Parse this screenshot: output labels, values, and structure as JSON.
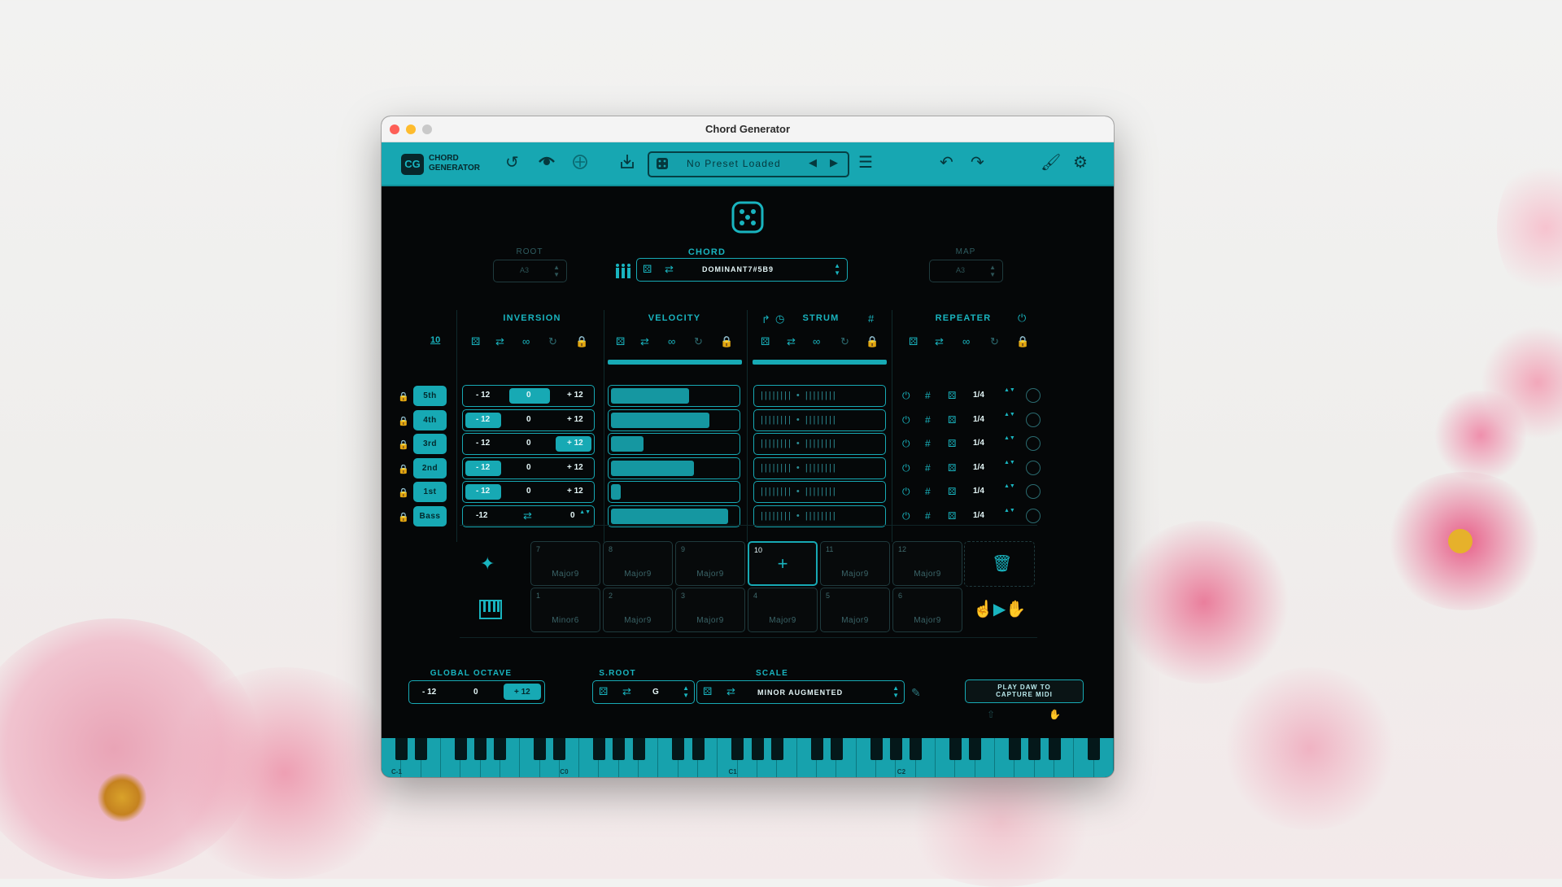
{
  "window": {
    "title": "Chord Generator"
  },
  "toolbar": {
    "logo_badge": "CG",
    "logo_line1": "CHORD",
    "logo_line2": "GENERATOR",
    "preset_name": "No Preset Loaded",
    "icons": [
      "undo-circle-icon",
      "eye-icon",
      "target-icon",
      "download-icon",
      "dice-icon",
      "prev-arrow-icon",
      "next-arrow-icon",
      "menu-icon",
      "undo-icon",
      "redo-icon",
      "brush-icon",
      "gear-icon"
    ]
  },
  "top": {
    "root_label": "ROOT",
    "root_value": "A3",
    "chord_label": "CHORD",
    "chord_value": "DOMINANT7#5B9",
    "map_label": "MAP",
    "map_value": "A3"
  },
  "sections": {
    "inversion": "INVERSION",
    "velocity": "VELOCITY",
    "strum": "STRUM",
    "repeater": "REPEATER",
    "note_count": "10"
  },
  "rows": [
    {
      "tag": "5th",
      "neg": "- 12",
      "mid": "0",
      "pos": "+ 12",
      "inv_fill": "mid",
      "velocity": 0.62,
      "rate": "1/4"
    },
    {
      "tag": "4th",
      "neg": "- 12",
      "mid": "0",
      "pos": "+ 12",
      "inv_fill": "neg",
      "velocity": 0.78,
      "rate": "1/4"
    },
    {
      "tag": "3rd",
      "neg": "- 12",
      "mid": "0",
      "pos": "+ 12",
      "inv_fill": "pos",
      "velocity": 0.26,
      "rate": "1/4"
    },
    {
      "tag": "2nd",
      "neg": "- 12",
      "mid": "0",
      "pos": "+ 12",
      "inv_fill": "neg",
      "velocity": 0.66,
      "rate": "1/4"
    },
    {
      "tag": "1st",
      "neg": "- 12",
      "mid": "0",
      "pos": "+ 12",
      "inv_fill": "neg",
      "velocity": 0.08,
      "rate": "1/4"
    },
    {
      "tag": "Bass",
      "neg": "-12",
      "mid": "",
      "pos": "0",
      "inv_fill": "none",
      "velocity": 0.93,
      "rate": "1/4"
    }
  ],
  "pads": [
    {
      "num": "7",
      "name": "Major9"
    },
    {
      "num": "8",
      "name": "Major9"
    },
    {
      "num": "9",
      "name": "Major9"
    },
    {
      "num": "10",
      "name": "+"
    },
    {
      "num": "11",
      "name": "Major9"
    },
    {
      "num": "12",
      "name": "Major9"
    },
    {
      "num": "1",
      "name": "Minor6"
    },
    {
      "num": "2",
      "name": "Major9"
    },
    {
      "num": "3",
      "name": "Major9"
    },
    {
      "num": "4",
      "name": "Major9"
    },
    {
      "num": "5",
      "name": "Major9"
    },
    {
      "num": "6",
      "name": "Major9"
    }
  ],
  "bottom": {
    "global_octave_label": "GLOBAL OCTAVE",
    "oct_neg": "- 12",
    "oct_mid": "0",
    "oct_pos": "+ 12",
    "sroot_label": "S.ROOT",
    "sroot_value": "G",
    "scale_label": "SCALE",
    "scale_value": "MINOR AUGMENTED",
    "capture_line1": "PLAY DAW TO",
    "capture_line2": "CAPTURE MIDI"
  },
  "keyboard": {
    "labels": [
      "C-1",
      "C0",
      "C1",
      "C2"
    ]
  },
  "colors": {
    "accent": "#17a9b4",
    "background": "#050708"
  }
}
